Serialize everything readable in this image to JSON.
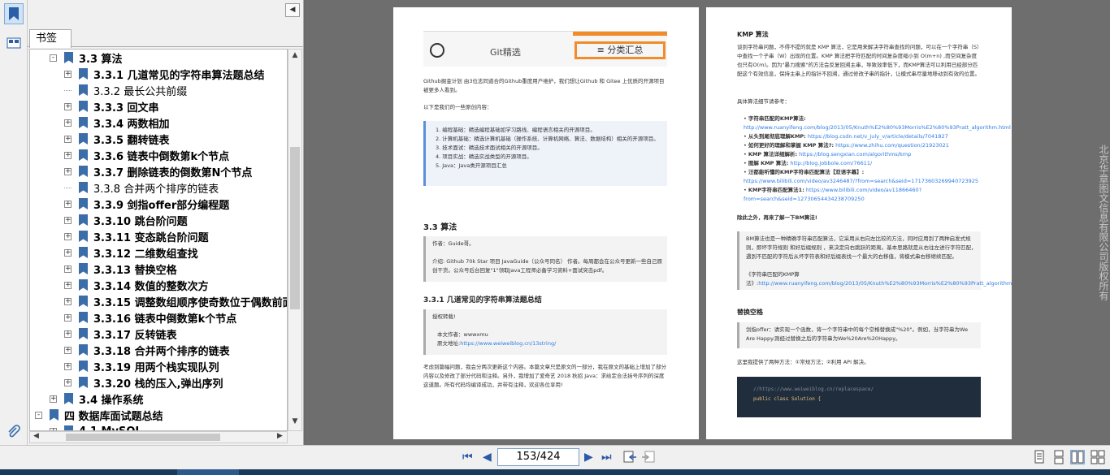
{
  "panel": {
    "tab_label": "书签",
    "tree": [
      {
        "label": "3.3 算法",
        "indent": 1,
        "expand": "-",
        "bold": true
      },
      {
        "label": "3.3.1 几道常见的字符串算法题总结",
        "indent": 2,
        "expand": "+",
        "bold": true
      },
      {
        "label": "3.3.2 最长公共前缀",
        "indent": 2,
        "expand": "",
        "bold": false
      },
      {
        "label": "3.3.3 回文串",
        "indent": 2,
        "expand": "+",
        "bold": true
      },
      {
        "label": "3.3.4 两数相加",
        "indent": 2,
        "expand": "+",
        "bold": true
      },
      {
        "label": "3.3.5 翻转链表",
        "indent": 2,
        "expand": "+",
        "bold": true
      },
      {
        "label": "3.3.6 链表中倒数第k个节点",
        "indent": 2,
        "expand": "+",
        "bold": true
      },
      {
        "label": "3.3.7 删除链表的倒数第N个节点",
        "indent": 2,
        "expand": "+",
        "bold": true
      },
      {
        "label": "3.3.8 合并两个排序的链表",
        "indent": 2,
        "expand": "",
        "bold": false
      },
      {
        "label": "3.3.9 剑指offer部分编程题",
        "indent": 2,
        "expand": "+",
        "bold": true
      },
      {
        "label": "3.3.10 跳台阶问题",
        "indent": 2,
        "expand": "+",
        "bold": true
      },
      {
        "label": "3.3.11 变态跳台阶问题",
        "indent": 2,
        "expand": "+",
        "bold": true
      },
      {
        "label": "3.3.12 二维数组查找",
        "indent": 2,
        "expand": "+",
        "bold": true
      },
      {
        "label": "3.3.13 替换空格",
        "indent": 2,
        "expand": "+",
        "bold": true
      },
      {
        "label": "3.3.14 数值的整数次方",
        "indent": 2,
        "expand": "+",
        "bold": true
      },
      {
        "label": "3.3.15 调整数组顺序使奇数位于偶数前面",
        "indent": 2,
        "expand": "+",
        "bold": true
      },
      {
        "label": "3.3.16 链表中倒数第k个节点",
        "indent": 2,
        "expand": "+",
        "bold": true
      },
      {
        "label": "3.3.17 反转链表",
        "indent": 2,
        "expand": "+",
        "bold": true
      },
      {
        "label": "3.3.18 合并两个排序的链表",
        "indent": 2,
        "expand": "+",
        "bold": true
      },
      {
        "label": "3.3.19 用两个栈实现队列",
        "indent": 2,
        "expand": "+",
        "bold": true
      },
      {
        "label": "3.3.20 栈的压入,弹出序列",
        "indent": 2,
        "expand": "+",
        "bold": true
      },
      {
        "label": "3.4 操作系统",
        "indent": 1,
        "expand": "+",
        "bold": true
      },
      {
        "label": "四 数据库面试题总结",
        "indent": 0,
        "expand": "-",
        "bold": true
      },
      {
        "label": "4.1 MySQL",
        "indent": 1,
        "expand": "+",
        "bold": true
      }
    ]
  },
  "page_left": {
    "git_label": "Git精选",
    "classify_label": "≡ 分类汇总",
    "intro": "Github掘金计划 由3位志同道合的Github重度用户维护，我们想让Github 和 Gitee 上优质的开源项目被更多人看到。",
    "intro_bold": "Github掘金计划",
    "list_intro": "以下是我们的一些原创内容：",
    "list": [
      "1. 编程基础：精选编程基础如学习路线、编程语言相关的开源项目。",
      "2. 计算机基础：精选计算机基础（操作系统、计算机网络、算法、数据结构）相关的开源项目。",
      "3. 技术面试：精选技术面试相关的开源项目。",
      "4. 项目实战：精选实战类型的开源项目。",
      "5. Java：Java类开源项目汇总"
    ],
    "h_algo": "3.3 算法",
    "author_line": "作者：Guide哥。",
    "author_intro": "介绍: Github 70k Star 项目 JavaGuide（公众号同名） 作者。每周都会在公众号更新一些自己原创干货。公众号后台回复\"1\"领取Java工程师必备学习资料+面试突击pdf。",
    "h_string": "3.3.1 几道常见的字符串算法题总结",
    "authorized": "授权转载!",
    "article_author": "本文作者：wwwxmu",
    "article_link_prefix": "原文地址:",
    "article_link": "https://www.weiweiblog.cn/13string/",
    "closing": "考虑到篇幅问题，我会分两次更新这个内容。本篇文章只是原文的一部分，我在原文的基础上增加了部分内容以及修改了部分代码和注释。另外，我增加了爱奇艺 2018 秋招 Java：求给定合法括号序列的深度 这道题。所有代码均编译成功，并带有注释，欢迎各位享用!"
  },
  "page_right": {
    "h_kmp": "KMP 算法",
    "kmp_para": "谈到字符串问题，不得不提的就是 KMP 算法，它是用来解决字符串查找的问题，可以在一个字符串（S）中查找一个子串（W）出现的位置。KMP 算法把字符匹配的时间复杂度缩小到 O(m+n) ,而空间复杂度也只有O(m)。因为\"暴力搜索\"的方法会反复回溯主串，导致效率低下，而KMP算法可以利用已经部分匹配这个有效信息，保持主串上的指针不回溯，通过修改子串的指针，让模式串尽量地移动到有效的位置。",
    "ref_intro": "具体算法细节请参考：",
    "refs": [
      {
        "label": "字符串匹配的KMP算法:",
        "url": "http://www.ruanyifeng.com/blog/2013/05/Knuth%E2%80%93Morris%E2%80%93Pratt_algorithm.html"
      },
      {
        "label": "从头到尾彻底理解KMP:",
        "url": "https://blog.csdn.net/v_july_v/article/details/7041827"
      },
      {
        "label": "如何更好的理解和掌握 KMP 算法?:",
        "url": "https://www.zhihu.com/question/21923021"
      },
      {
        "label": "KMP 算法详细解析:",
        "url": "https://blog.sengxian.com/algorithms/kmp"
      },
      {
        "label": "图解 KMP 算法:",
        "url": "http://blog.jobbole.com/76611/"
      },
      {
        "label": "汪都能听懂的KMP字符串匹配算法【双语字幕】:",
        "url": "https://www.bilibili.com/video/av3246487/?from=search&seid=17173603269940723925"
      },
      {
        "label": "KMP字符串匹配算法1:",
        "url": "https://www.bilibili.com/video/av11866460?from=search&seid=12730654434238709250"
      }
    ],
    "bm_intro": "除此之外，再来了解一下BM算法!",
    "bm_para": "BM算法也是一种精确字符串匹配算法，它采用从右向左比较的方法，同时应用到了两种启发式规则，即坏字符规则 和好后缀规则 ，来决定向右跳跃的距离。基本思路就是从右往左进行字符匹配，遇到不匹配的字符后从坏字符表和好后缀表找一个最大的右移值，将模式串右移继续匹配。",
    "bm_link_prefix": "《字符串匹配的KMP算法》:",
    "bm_link": "http://www.ruanyifeng.com/blog/2013/05/Knuth%E2%80%93Morris%E2%80%93Pratt_algorithm.html",
    "h_space": "替换空格",
    "space_quote": "剑指offer：请实现一个函数，将一个字符串中的每个空格替换成\"%20\"。例如，当字符串为We Are Happy.则经过替换之后的字符串为We%20Are%20Happy。",
    "space_methods": "这里我提供了两种方法：①常规方法；②利用 API 解决。",
    "code_comment": "//https://www.weiweiblog.cn/replacespace/",
    "code_line": "public class Solution {"
  },
  "watermark": "北京华章图文信息有限公司版权所有",
  "toolbar": {
    "page_indicator": "153/424"
  }
}
